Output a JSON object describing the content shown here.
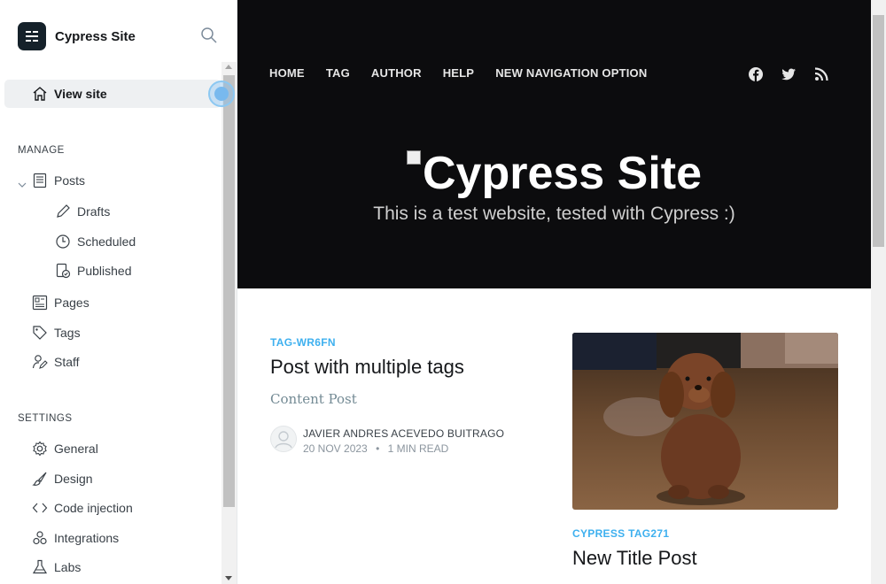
{
  "brand": {
    "name": "Cypress Site"
  },
  "sidebar": {
    "view_site": "View site",
    "manage_title": "MANAGE",
    "settings_title": "SETTINGS",
    "posts": "Posts",
    "drafts": "Drafts",
    "scheduled": "Scheduled",
    "published": "Published",
    "pages": "Pages",
    "tags": "Tags",
    "staff": "Staff",
    "general": "General",
    "design": "Design",
    "code_injection": "Code injection",
    "integrations": "Integrations",
    "labs": "Labs"
  },
  "site": {
    "nav": [
      "HOME",
      "TAG",
      "AUTHOR",
      "HELP",
      "NEW NAVIGATION OPTION"
    ],
    "social_icons": [
      "facebook-icon",
      "twitter-icon",
      "rss-icon"
    ],
    "title": "Cypress Site",
    "description": "This is a test website, tested with Cypress :)",
    "post1": {
      "tag": "TAG-WR6FN",
      "title": "Post with multiple tags",
      "excerpt": "Content Post",
      "author": "JAVIER ANDRES ACEVEDO BUITRAGO",
      "date": "20 NOV 2023",
      "separator": "•",
      "read_time": "1 MIN READ"
    },
    "post2": {
      "tag": "CYPRESS TAG271",
      "title": "New Title Post"
    }
  },
  "colors": {
    "accent": "#3eb0ef",
    "hero_bg": "#0c0c0e",
    "sidebar_active": "#eef0f2"
  }
}
